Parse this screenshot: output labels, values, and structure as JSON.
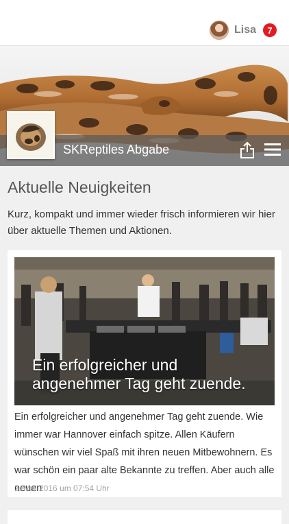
{
  "user": {
    "name": "Lisa",
    "notifications": "7"
  },
  "shop": {
    "title": "SKReptiles Abgabe"
  },
  "news": {
    "heading": "Aktuelle Neuigkeiten",
    "intro": "Kurz, kompakt und immer wieder frisch informieren wir hier über aktuelle Themen und Aktionen."
  },
  "article": {
    "image_title": "Ein erfolgreicher und angenehmer Tag geht zuende.",
    "excerpt": "Ein erfolgreicher und angenehmer Tag geht zuende. Wie immer war Hannover einfach spitze. Allen Käufern wünschen wir viel Spaß mit ihren neuen Mitbewohnern. Es war schön ein paar alte Bekannte zu treffen. Aber auch alle neuen",
    "date": "2. Mai 2016 um 07:54 Uhr"
  },
  "icons": {
    "share": "share-icon",
    "menu": "hamburger-menu-icon",
    "avatar": "avatar"
  },
  "colors": {
    "badge": "#e21b23",
    "hero_bar": "#5a5a5a",
    "background": "#f0f0f0"
  }
}
